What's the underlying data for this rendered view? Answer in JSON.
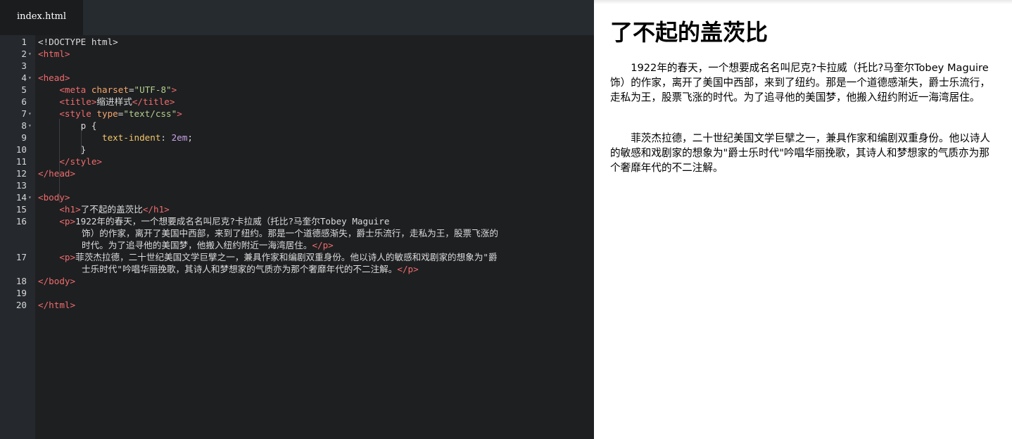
{
  "editor": {
    "tab_label": "index.html",
    "lines": [
      {
        "n": "1",
        "fold": "",
        "parts": [
          {
            "t": "<!DOCTYPE html>",
            "c": "plain"
          }
        ]
      },
      {
        "n": "2",
        "fold": "▾",
        "parts": [
          {
            "t": "<html>",
            "c": "tag"
          }
        ]
      },
      {
        "n": "3",
        "fold": "",
        "parts": []
      },
      {
        "n": "4",
        "fold": "▾",
        "parts": [
          {
            "t": "<head>",
            "c": "tag"
          }
        ]
      },
      {
        "n": "5",
        "fold": "",
        "parts": [
          {
            "t": "    "
          },
          {
            "t": "<meta",
            "c": "tag"
          },
          {
            "t": " charset",
            "c": "attr"
          },
          {
            "t": "=",
            "c": "plain"
          },
          {
            "t": "\"UTF-8\"",
            "c": "str"
          },
          {
            "t": ">",
            "c": "tag"
          }
        ]
      },
      {
        "n": "6",
        "fold": "",
        "parts": [
          {
            "t": "    "
          },
          {
            "t": "<title>",
            "c": "tag"
          },
          {
            "t": "缩进样式",
            "c": "plain"
          },
          {
            "t": "</title>",
            "c": "tag"
          }
        ]
      },
      {
        "n": "7",
        "fold": "▾",
        "parts": [
          {
            "t": "    "
          },
          {
            "t": "<style",
            "c": "tag"
          },
          {
            "t": " type",
            "c": "attr"
          },
          {
            "t": "=",
            "c": "plain"
          },
          {
            "t": "\"text/css\"",
            "c": "str"
          },
          {
            "t": ">",
            "c": "tag"
          }
        ]
      },
      {
        "n": "8",
        "fold": "▾",
        "parts": [
          {
            "t": "        p {",
            "c": "plain"
          }
        ]
      },
      {
        "n": "9",
        "fold": "",
        "parts": [
          {
            "t": "            "
          },
          {
            "t": "text-indent",
            "c": "prop"
          },
          {
            "t": ": ",
            "c": "plain"
          },
          {
            "t": "2em",
            "c": "num"
          },
          {
            "t": ";",
            "c": "plain"
          }
        ]
      },
      {
        "n": "10",
        "fold": "",
        "parts": [
          {
            "t": "        }",
            "c": "plain"
          }
        ]
      },
      {
        "n": "11",
        "fold": "",
        "parts": [
          {
            "t": "    "
          },
          {
            "t": "</style>",
            "c": "tag"
          }
        ]
      },
      {
        "n": "12",
        "fold": "",
        "parts": [
          {
            "t": "</head>",
            "c": "tag"
          }
        ]
      },
      {
        "n": "13",
        "fold": "",
        "parts": []
      },
      {
        "n": "14",
        "fold": "▾",
        "parts": [
          {
            "t": "<body>",
            "c": "tag"
          }
        ]
      },
      {
        "n": "15",
        "fold": "",
        "parts": [
          {
            "t": "    "
          },
          {
            "t": "<h1>",
            "c": "tag"
          },
          {
            "t": "了不起的盖茨比",
            "c": "plain"
          },
          {
            "t": "</h1>",
            "c": "tag"
          }
        ]
      },
      {
        "n": "16",
        "fold": "",
        "parts": [
          {
            "t": "    "
          },
          {
            "t": "<p>",
            "c": "tag"
          },
          {
            "t": "1922年的春天，一个想要成名名叫尼克?卡拉威（托比?马奎尔Tobey Maguire",
            "c": "plain"
          }
        ],
        "cont": [
          [
            {
              "t": "饰）的作家，离开了美国中西部，来到了纽约。那是一个道德感渐失，爵士乐流行，走私为王，股票飞涨的",
              "c": "plain"
            }
          ],
          [
            {
              "t": "时代。为了追寻他的美国梦，他搬入纽约附近一海湾居住。",
              "c": "plain"
            },
            {
              "t": "</p>",
              "c": "tag"
            }
          ]
        ]
      },
      {
        "n": "17",
        "fold": "",
        "parts": [
          {
            "t": "    "
          },
          {
            "t": "<p>",
            "c": "tag"
          },
          {
            "t": "菲茨杰拉德，二十世纪美国文学巨擘之一，兼具作家和编剧双重身份。他以诗人的敏感和戏剧家的想象为\"爵",
            "c": "plain"
          }
        ],
        "cont": [
          [
            {
              "t": "士乐时代\"吟唱华丽挽歌，其诗人和梦想家的气质亦为那个奢靡年代的不二注解。",
              "c": "plain"
            },
            {
              "t": "</p>",
              "c": "tag"
            }
          ]
        ]
      },
      {
        "n": "18",
        "fold": "",
        "parts": [
          {
            "t": "</body>",
            "c": "tag"
          }
        ]
      },
      {
        "n": "19",
        "fold": "",
        "parts": []
      },
      {
        "n": "20",
        "fold": "",
        "parts": [
          {
            "t": "</html>",
            "c": "tag"
          }
        ]
      }
    ]
  },
  "preview": {
    "title": "了不起的盖茨比",
    "paragraphs": [
      "1922年的春天，一个想要成名名叫尼克?卡拉威（托比?马奎尔Tobey Maguire 饰）的作家，离开了美国中西部，来到了纽约。那是一个道德感渐失，爵士乐流行，走私为王，股票飞涨的时代。为了追寻他的美国梦，他搬入纽约附近一海湾居住。",
      "菲茨杰拉德，二十世纪美国文学巨擘之一，兼具作家和编剧双重身份。他以诗人的敏感和戏剧家的想象为\"爵士乐时代\"吟唱华丽挽歌，其诗人和梦想家的气质亦为那个奢靡年代的不二注解。"
    ]
  },
  "colors": {
    "editor_bg": "#1e1f21",
    "gutter_bg": "#25282d",
    "tab_bar_bg": "#262b30",
    "tag": "#f06c6c",
    "attribute": "#f5a76c",
    "string": "#b5cf8d",
    "property": "#f2c76a",
    "number": "#c9a2e6"
  }
}
